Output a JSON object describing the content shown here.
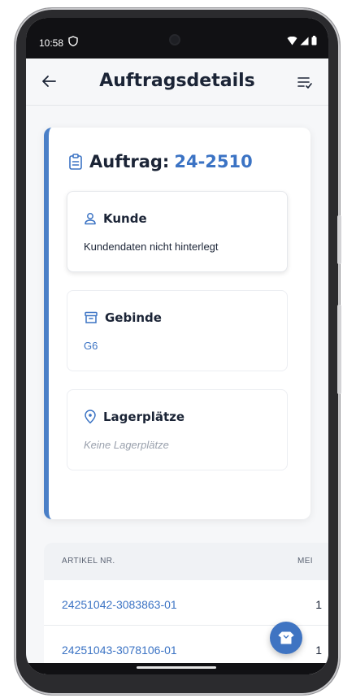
{
  "status_bar": {
    "time": "10:58"
  },
  "app_bar": {
    "title": "Auftragsdetails"
  },
  "order": {
    "label": "Auftrag:",
    "number": "24-2510",
    "accent_color": "#4a7fc7"
  },
  "sections": {
    "customer": {
      "title": "Kunde",
      "value": "Kundendaten nicht hinterlegt"
    },
    "container": {
      "title": "Gebinde",
      "value": "G6"
    },
    "storage": {
      "title": "Lagerplätze",
      "value": "Keine Lagerplätze"
    }
  },
  "table": {
    "headers": {
      "article": "ARTIKEL NR.",
      "quantity": "MEI"
    },
    "rows": [
      {
        "article": "24251042-3083863-01",
        "quantity": "1"
      },
      {
        "article": "24251043-3078106-01",
        "quantity": "1"
      }
    ]
  },
  "icons": {
    "back": "arrow-left-icon",
    "menu": "checklist-icon",
    "order": "clipboard-icon",
    "customer": "person-icon",
    "container": "archive-box-icon",
    "storage": "location-pin-icon",
    "fab": "package-icon"
  }
}
